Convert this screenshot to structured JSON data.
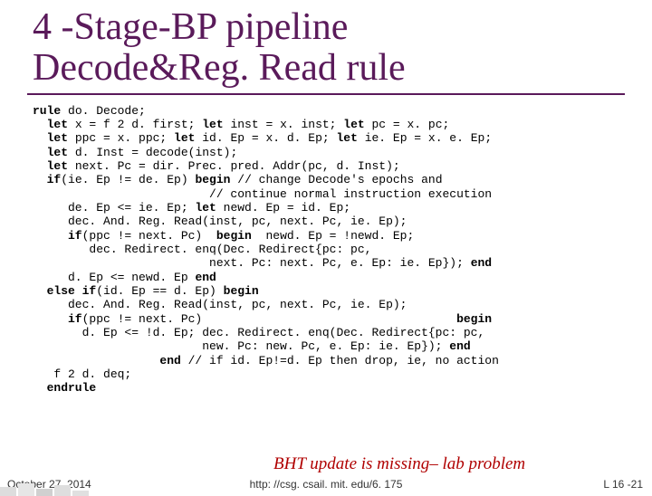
{
  "title_line1": "4 -Stage-BP pipeline",
  "title_line2": "Decode&Reg. Read rule",
  "code": {
    "l01a": "rule",
    "l01b": " do. Decode;",
    "l02a": "  let",
    "l02b": " x = f 2 d. first; ",
    "l02c": "let",
    "l02d": " inst = x. inst; ",
    "l02e": "let",
    "l02f": " pc = x. pc;",
    "l03a": "  let",
    "l03b": " ppc = x. ppc; ",
    "l03c": "let",
    "l03d": " id. Ep = x. d. Ep; ",
    "l03e": "let",
    "l03f": " ie. Ep = x. e. Ep;",
    "l04a": "  let",
    "l04b": " d. Inst = decode(inst);",
    "l05a": "  let",
    "l05b": " next. Pc = dir. Prec. pred. Addr(pc, d. Inst);",
    "l06a": "  if",
    "l06b": "(ie. Ep != de. Ep) ",
    "l06c": "begin",
    "l06d": " // change Decode's epochs and",
    "l07": "                         // continue normal instruction execution",
    "l08a": "     de. Ep <= ie. Ep; ",
    "l08b": "let",
    "l08c": " newd. Ep = id. Ep;",
    "l09": "     dec. And. Reg. Read(inst, pc, next. Pc, ie. Ep);",
    "l10a": "     if",
    "l10b": "(ppc != next. Pc)  ",
    "l10c": "begin",
    "l10d": "  newd. Ep = !newd. Ep;",
    "l11": "        dec. Redirect. enq(Dec. Redirect{pc: pc,",
    "l12a": "                         next. Pc: next. Pc, e. Ep: ie. Ep}); ",
    "l12b": "end",
    "l13a": "     d. Ep <= newd. Ep ",
    "l13b": "end",
    "l14a": "  else if",
    "l14b": "(id. Ep == d. Ep) ",
    "l14c": "begin",
    "l15": "     dec. And. Reg. Read(inst, pc, next. Pc, ie. Ep);",
    "l16a": "     if",
    "l16b": "(ppc != next. Pc)                                    ",
    "l16c": "begin",
    "l17": "       d. Ep <= !d. Ep; dec. Redirect. enq(Dec. Redirect{pc: pc,",
    "l18a": "                        new. Pc: new. Pc, e. Ep: ie. Ep}); ",
    "l18b": "end",
    "l19a": "                  end",
    "l19b": " // if id. Ep!=d. Ep then drop, ie, no action",
    "l20": "   f 2 d. deq;",
    "l21": "  endrule"
  },
  "bht_note": "BHT update is missing– lab problem",
  "footer": {
    "date": "October 27, 2014",
    "url": "http: //csg. csail. mit. edu/6. 175",
    "page": "L 16 -21"
  }
}
